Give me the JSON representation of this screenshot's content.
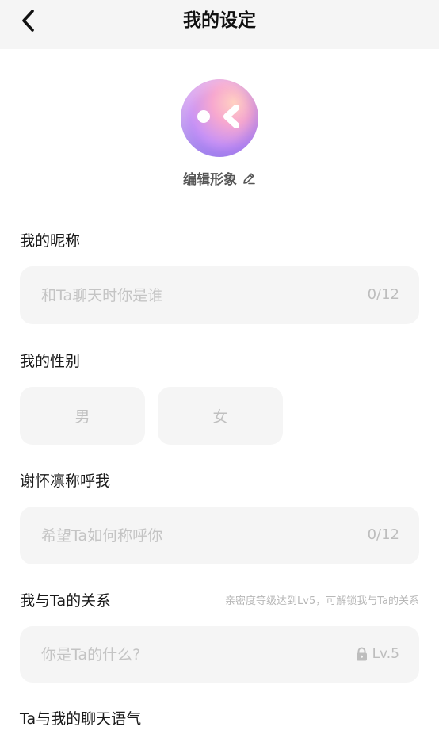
{
  "header": {
    "title": "我的设定"
  },
  "avatar": {
    "edit_label": "编辑形象"
  },
  "nickname": {
    "label": "我的昵称",
    "placeholder": "和Ta聊天时你是谁",
    "counter": "0/12"
  },
  "gender": {
    "label": "我的性别",
    "options": [
      "男",
      "女"
    ]
  },
  "call_me": {
    "label": "谢怀凛称呼我",
    "placeholder": "希望Ta如何称呼你",
    "counter": "0/12"
  },
  "relation": {
    "label": "我与Ta的关系",
    "hint": "亲密度等级达到Lv5，可解锁我与Ta的关系",
    "placeholder": "你是Ta的什么?",
    "lock_level": "Lv.5"
  },
  "tone": {
    "label": "Ta与我的聊天语气"
  }
}
